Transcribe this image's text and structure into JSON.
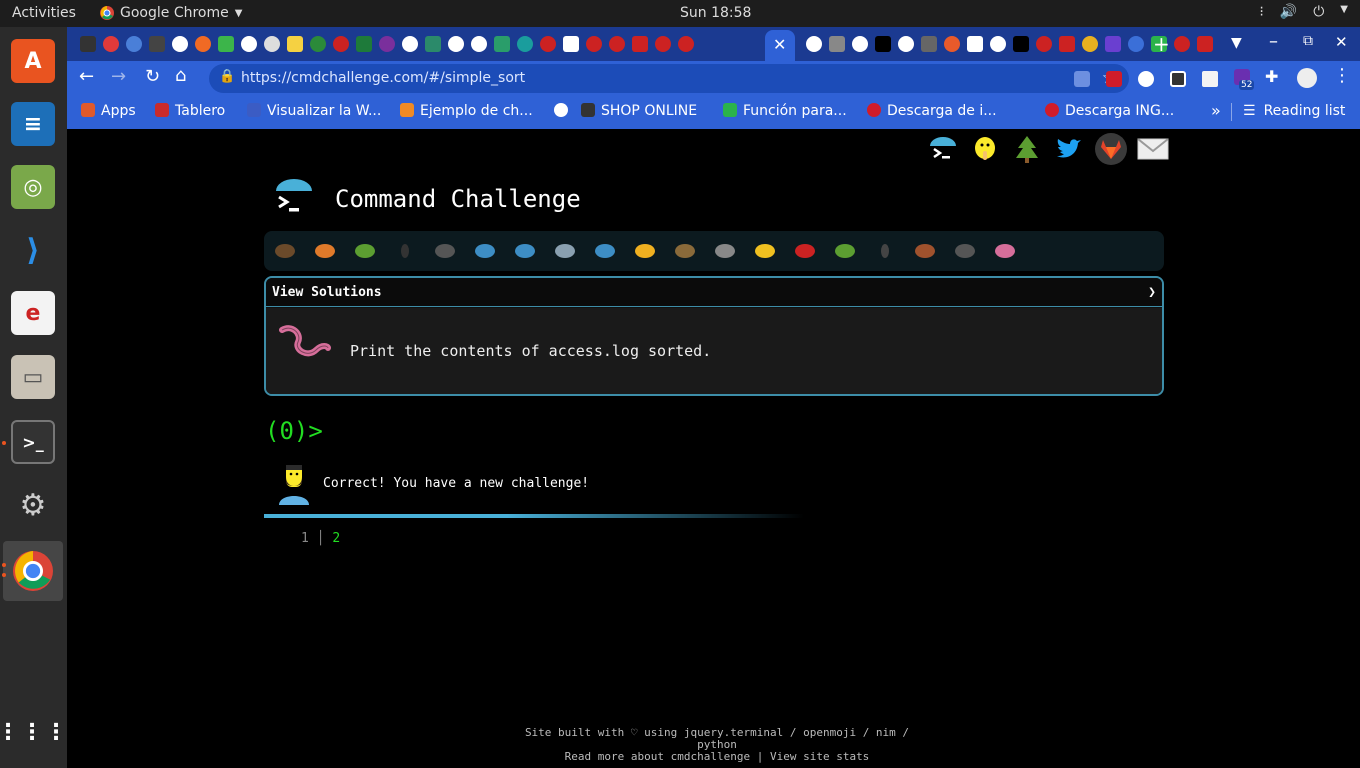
{
  "system": {
    "activities": "Activities",
    "app_name": "Google Chrome",
    "clock": "Sun 18:58"
  },
  "browser": {
    "url": "https://cmdchallenge.com/#/simple_sort",
    "extension_badge": "52",
    "bookmarks": [
      {
        "label": "Apps",
        "color": "#e05a2b"
      },
      {
        "label": "Tablero",
        "color": "#c92b2b"
      },
      {
        "label": "Visualizar la W...",
        "color": "#3b5cc4"
      },
      {
        "label": "Ejemplo de ch...",
        "color": "#f08a24"
      },
      {
        "label": "",
        "color": "#ffffff"
      },
      {
        "label": "SHOP ONLINE",
        "color": "#333333"
      },
      {
        "label": "Función para...",
        "color": "#2bb34a"
      },
      {
        "label": "Descarga de i...",
        "color": "#d01c2a"
      },
      {
        "label": "Descarga ING...",
        "color": "#d01c2a"
      }
    ],
    "reading_list": "Reading list"
  },
  "page": {
    "title": "Command Challenge",
    "panel_header": "View Solutions",
    "panel_arrow": "❯",
    "challenge_text": "Print the contents of access.log sorted.",
    "prompt": "(0)>",
    "message": "Correct! You have a new challenge!",
    "output_line_number": "1",
    "output_value": "2",
    "footer_line1": "Site built with ♡ using jquery.terminal / openmoji / nim / python",
    "footer_line2": "Read more about cmdchallenge | View site stats"
  },
  "colors": {
    "accent_blue": "#2f61d6",
    "panel_border": "#3d8da8",
    "prompt_green": "#22dd22",
    "progress": "#49b0d8"
  }
}
